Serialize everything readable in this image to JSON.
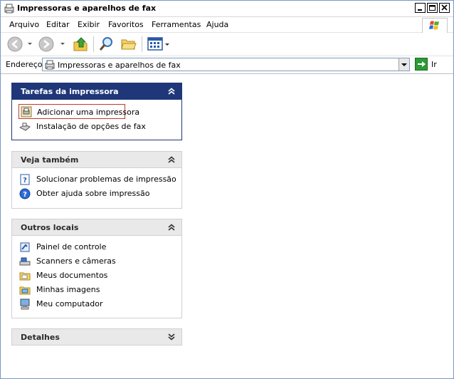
{
  "window": {
    "title": "Impressoras e aparelhos de fax"
  },
  "menu": [
    "Arquivo",
    "Editar",
    "Exibir",
    "Favoritos",
    "Ferramentas",
    "Ajuda"
  ],
  "address": {
    "label": "Endereço",
    "value": "Impressoras e aparelhos de fax",
    "go_label": "Ir"
  },
  "panels": {
    "printer_tasks": {
      "title": "Tarefas da impressora",
      "items": [
        "Adicionar uma impressora",
        "Instalação de opções de fax"
      ]
    },
    "see_also": {
      "title": "Veja também",
      "items": [
        "Solucionar problemas de impressão",
        "Obter ajuda sobre impressão"
      ]
    },
    "other_places": {
      "title": "Outros locais",
      "items": [
        "Painel de controle",
        "Scanners e câmeras",
        "Meus documentos",
        "Minhas imagens",
        "Meu computador"
      ]
    },
    "details": {
      "title": "Detalhes"
    }
  },
  "icons": {
    "back": "back-arrow-icon",
    "forward": "forward-arrow-icon",
    "up": "up-folder-icon",
    "search": "search-icon",
    "folders": "folders-icon",
    "views": "views-icon",
    "go": "go-arrow-icon"
  }
}
